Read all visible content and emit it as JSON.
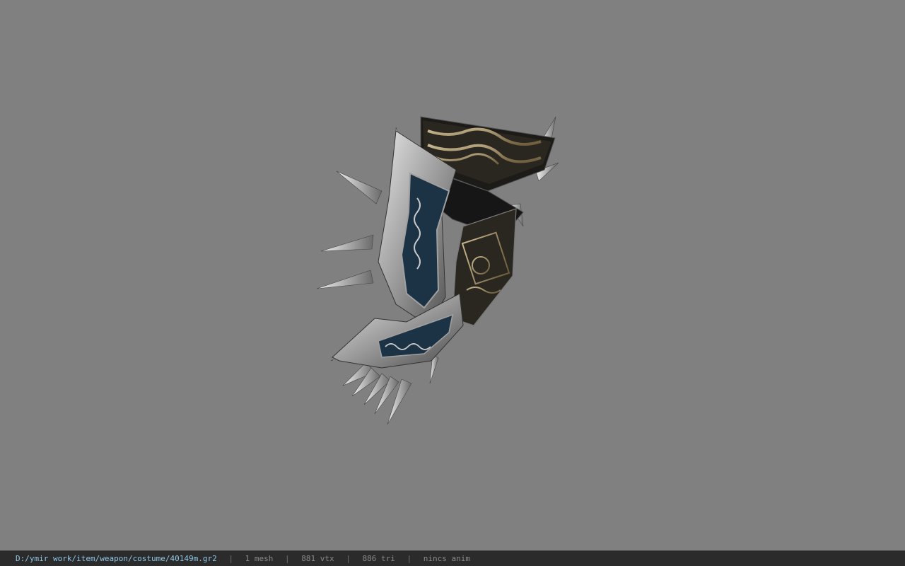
{
  "viewport": {
    "background": "#808080",
    "model_icon": "spiked-gauntlet-3d-model"
  },
  "statusbar": {
    "file_path": "D:/ymir work/item/weapon/costume/40149m.gr2",
    "separator": "|",
    "mesh_count": "1 mesh",
    "vertex_count": "881 vtx",
    "triangle_count": "886 tri",
    "animation": "nincs anim",
    "path_color": "#8fc7e8",
    "text_color": "#8a8a8a"
  }
}
